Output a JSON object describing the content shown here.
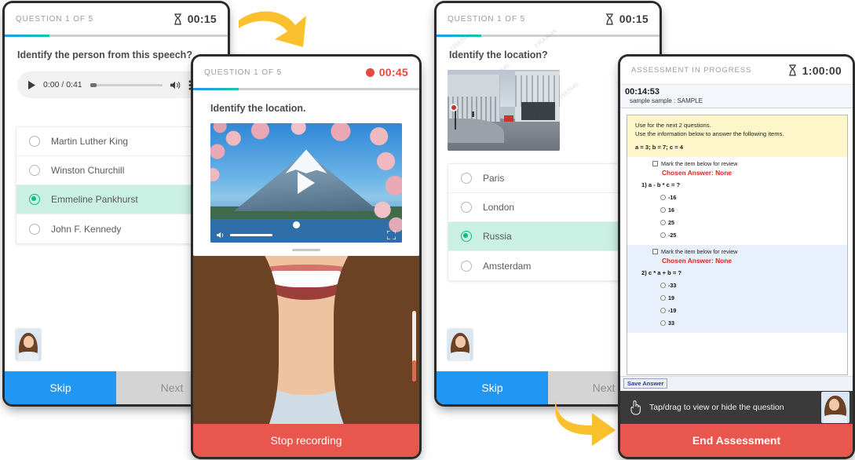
{
  "panel1": {
    "header_label": "QUESTION 1 OF 5",
    "timer": "00:15",
    "timer_icon": "hourglass-icon",
    "progress_percent": 20,
    "question": "Identify the person from this speech?",
    "audio": {
      "play_icon": "play-icon",
      "time": "0:00 / 0:41",
      "volume_icon": "volume-icon",
      "menu_icon": "kebab-menu-icon"
    },
    "options": [
      {
        "label": "Martin Luther King",
        "selected": false
      },
      {
        "label": "Winston Churchill",
        "selected": false
      },
      {
        "label": "Emmeline Pankhurst",
        "selected": true
      },
      {
        "label": "John F. Kennedy",
        "selected": false
      }
    ],
    "nav": {
      "skip": "Skip",
      "next": "Next"
    }
  },
  "panel2": {
    "header_label": "QUESTION 1 OF 5",
    "timer": "00:45",
    "timer_icon": "record-dot-icon",
    "progress_percent": 20,
    "question": "Identify the location.",
    "video": {
      "play_icon": "play-icon",
      "volume_icon": "volume-icon",
      "fullscreen_icon": "fullscreen-icon"
    },
    "stop_button": "Stop recording"
  },
  "panel3": {
    "header_label": "QUESTION 1 OF 5",
    "timer": "00:15",
    "timer_icon": "hourglass-icon",
    "progress_percent": 20,
    "question": "Identify the location?",
    "watermark": "23563546",
    "options": [
      {
        "label": "Paris",
        "selected": false
      },
      {
        "label": "London",
        "selected": false
      },
      {
        "label": "Russia",
        "selected": true
      },
      {
        "label": "Amsterdam",
        "selected": false
      }
    ],
    "nav": {
      "skip": "Skip",
      "next": "Next"
    }
  },
  "panel4": {
    "header_label": "ASSESSMENT IN PROGRESS",
    "timer": "1:00:00",
    "timer_icon": "hourglass-icon",
    "elapsed": "00:14:53",
    "candidate": "sample sample : SAMPLE",
    "stem": {
      "line1": "Use for the next 2 questions.",
      "line2": "Use the information below to answer the following items.",
      "vars": "a = 3; b = 7; c = 4"
    },
    "questions": [
      {
        "mark_label": "Mark the item below for review",
        "chosen": "Chosen Answer: None",
        "prompt": "1) a - b * c = ?",
        "answers": [
          "-16",
          "16",
          "25",
          "-25"
        ]
      },
      {
        "mark_label": "Mark the item below for review",
        "chosen": "Chosen Answer: None",
        "prompt": "2) c * a + b = ?",
        "answers": [
          "-33",
          "19",
          "-19",
          "33"
        ]
      }
    ],
    "save_button": "Save Answer",
    "tap_hint": "Tap/drag to view or hide the question",
    "tap_icon": "hand-tap-icon",
    "end_button": "End Assessment"
  },
  "colors": {
    "accent_blue": "#2196f3",
    "accent_teal": "#10c9a6",
    "selected_green": "#06c07c",
    "selected_row": "#c9f0e2",
    "danger_red": "#e8564d",
    "arrow_yellow": "#fbc02d",
    "stem_yellow": "#fcf6c8",
    "alt_blue": "#e8f1fb"
  }
}
